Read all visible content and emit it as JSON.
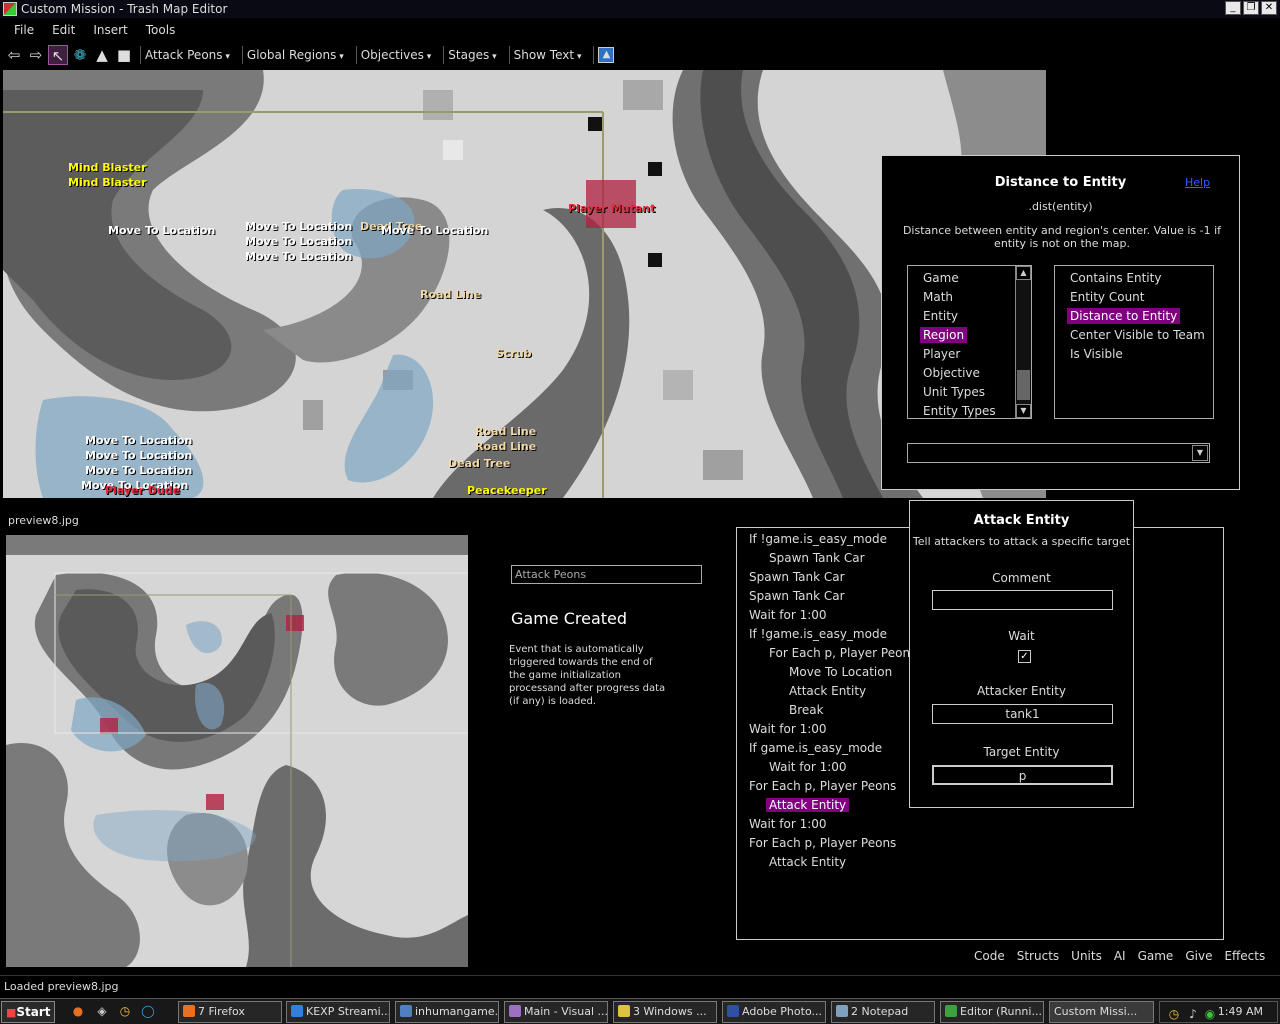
{
  "window": {
    "title": "Custom Mission - Trash Map Editor",
    "buttons": [
      "_",
      "❐",
      "✕"
    ]
  },
  "menu": [
    "File",
    "Edit",
    "Insert",
    "Tools"
  ],
  "toolbar": {
    "icons": [
      "back-arrow-icon",
      "forward-arrow-icon",
      "pointer-icon",
      "paint-icon",
      "brush-icon",
      "eraser-icon"
    ],
    "dropdowns": [
      "Attack Peons",
      "Global Regions",
      "Objectives",
      "Stages",
      "Show Text"
    ]
  },
  "map": {
    "labels": [
      {
        "text": "Mind Blaster",
        "color": "yellow"
      },
      {
        "text": "Mind Blaster",
        "color": "yellow"
      },
      {
        "text": "Move To Location",
        "color": "white"
      },
      {
        "text": "Move To Location",
        "color": "white"
      },
      {
        "text": "Move To Location",
        "color": "white"
      },
      {
        "text": "Move To Location",
        "color": "white"
      },
      {
        "text": "Dead Tree",
        "color": "tan"
      },
      {
        "text": "Move To Location",
        "color": "white"
      },
      {
        "text": "Player Mutant",
        "color": "red"
      },
      {
        "text": "Road Line",
        "color": "tan"
      },
      {
        "text": "Scrub",
        "color": "tan"
      },
      {
        "text": "Road Line",
        "color": "tan"
      },
      {
        "text": "Road Line",
        "color": "tan"
      },
      {
        "text": "Dead Tree",
        "color": "tan"
      },
      {
        "text": "Move To Location",
        "color": "white"
      },
      {
        "text": "Move To Location",
        "color": "white"
      },
      {
        "text": "Move To Location",
        "color": "white"
      },
      {
        "text": "Move To Location",
        "color": "white"
      },
      {
        "text": "Player Dude",
        "color": "red"
      },
      {
        "text": "Peacekeeper",
        "color": "yellow"
      }
    ]
  },
  "distance_dialog": {
    "title": "Distance to Entity",
    "help": "Help",
    "signature": ".dist(entity)",
    "description": "Distance between entity and region's center.  Value is -1 if entity is not on the map.",
    "categories": [
      "Game",
      "Math",
      "Entity",
      "Region",
      "Player",
      "Objective",
      "Unit Types",
      "Entity Types"
    ],
    "selected_category": "Region",
    "functions": [
      "Contains Entity",
      "Entity Count",
      "Distance to Entity",
      "Center Visible to Team",
      "Is Visible"
    ],
    "selected_function": "Distance to Entity",
    "combo_value": ""
  },
  "preview": {
    "label": "preview8.jpg"
  },
  "event": {
    "name_value": "Attack Peons",
    "title": "Game Created",
    "description": "Event that is automatically triggered towards the end of the game initialization processand after progress data (if any) is loaded."
  },
  "script": [
    {
      "text": "If !game.is_easy_mode",
      "indent": 0
    },
    {
      "text": "Spawn Tank Car",
      "indent": 1
    },
    {
      "text": "Spawn Tank Car",
      "indent": 0
    },
    {
      "text": "Spawn Tank Car",
      "indent": 0
    },
    {
      "text": "Wait for 1:00",
      "indent": 0
    },
    {
      "text": "If !game.is_easy_mode",
      "indent": 0
    },
    {
      "text": "For Each p, Player Peons",
      "indent": 1
    },
    {
      "text": "Move To Location",
      "indent": 2
    },
    {
      "text": "Attack Entity",
      "indent": 2
    },
    {
      "text": "Break",
      "indent": 2
    },
    {
      "text": "Wait for 1:00",
      "indent": 0
    },
    {
      "text": "If game.is_easy_mode",
      "indent": 0
    },
    {
      "text": "Wait for 1:00",
      "indent": 1
    },
    {
      "text": "For Each p, Player Peons",
      "indent": 0
    },
    {
      "text": "Attack Entity",
      "indent": 1,
      "selected": true
    },
    {
      "text": "Wait for 1:00",
      "indent": 0
    },
    {
      "text": "For Each p, Player Peons",
      "indent": 0
    },
    {
      "text": "Attack Entity",
      "indent": 1
    }
  ],
  "attack_dialog": {
    "title": "Attack Entity",
    "subtitle": "Tell attackers to attack a specific target",
    "comment_label": "Comment",
    "comment_value": "",
    "wait_label": "Wait",
    "wait_checked": true,
    "attacker_label": "Attacker Entity",
    "attacker_value": "tank1",
    "target_label": "Target Entity",
    "target_value": "p"
  },
  "bottom_tabs": [
    "Code",
    "Structs",
    "Units",
    "AI",
    "Game",
    "Give",
    "Effects"
  ],
  "status": "Loaded preview8.jpg",
  "taskbar": {
    "start": "Start",
    "tasks": [
      "7 Firefox",
      "KEXP Streami...",
      "inhumangame...",
      "Main - Visual ...",
      "3 Windows ...",
      "Adobe Photo...",
      "2 Notepad",
      "Editor (Runni...",
      "Custom Missi..."
    ],
    "clock": "1:49 AM"
  },
  "colors": {
    "selection": "#800080",
    "map_label_yellow": "#ffff00",
    "map_label_red": "#e03040",
    "help_link": "#3060ff"
  }
}
